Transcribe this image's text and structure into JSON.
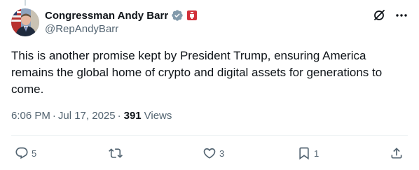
{
  "author": {
    "display_name": "Congressman Andy Barr",
    "handle": "@RepAndyBarr"
  },
  "tweet": {
    "text": "This is another promise kept by President Trump, ensuring America remains the global home of crypto and digital assets for generations to come.",
    "time": "6:06 PM",
    "date": "Jul 17, 2025",
    "separator": "·",
    "views_count": "391",
    "views_label": "Views"
  },
  "stats": {
    "replies": "5",
    "retweets": "",
    "likes": "3",
    "bookmarks": "1"
  },
  "icons": {
    "verified": "verified-badge-icon",
    "flag": "government-affiliation-icon",
    "grok": "grok-icon",
    "more": "more-icon",
    "reply": "reply-icon",
    "retweet": "retweet-icon",
    "like": "like-icon",
    "bookmark": "bookmark-icon",
    "share": "share-icon"
  },
  "colors": {
    "text_primary": "#0f1419",
    "text_secondary": "#536471",
    "divider": "#eff3f4",
    "verified_badge": "#829aab",
    "affiliation_badge": "#d1303a"
  }
}
